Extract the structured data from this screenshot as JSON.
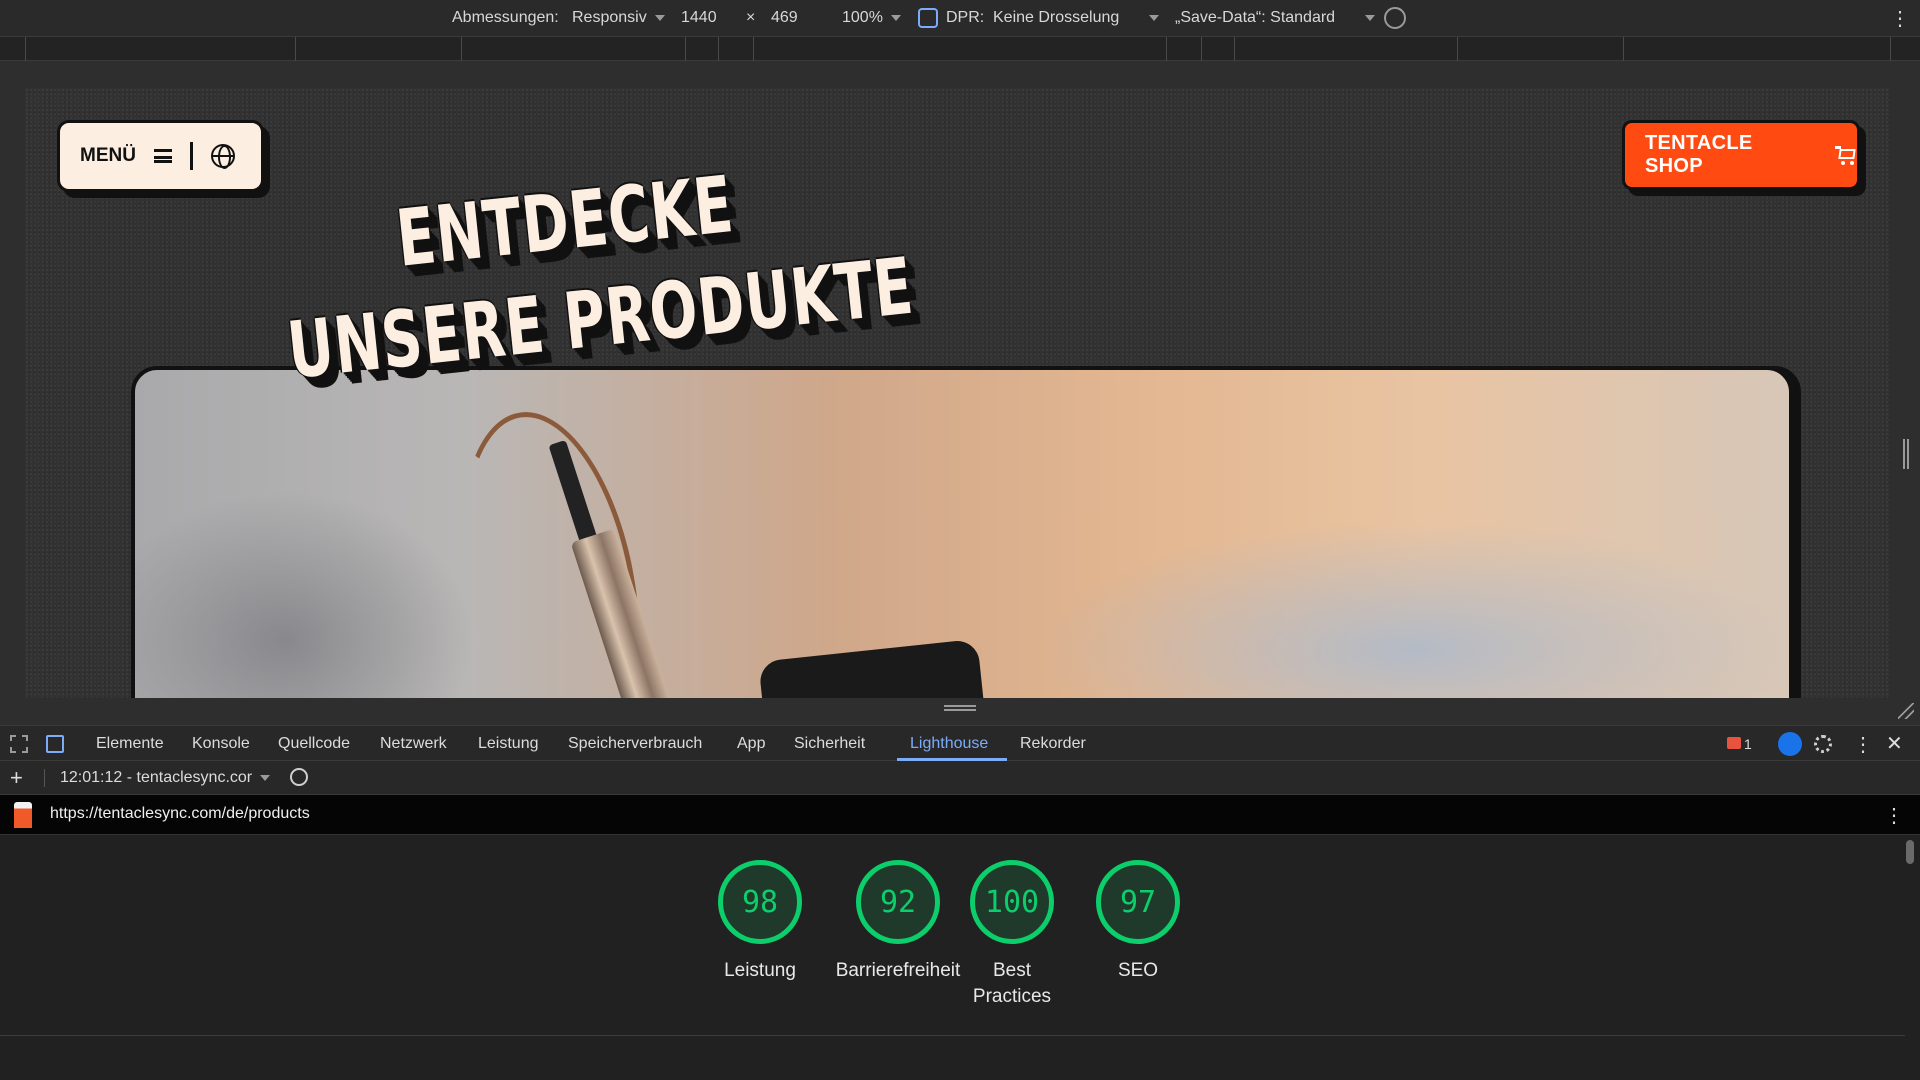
{
  "device_toolbar": {
    "dimensions_label": "Abmessungen:",
    "dimensions_value": "Responsiv",
    "width": "1440",
    "times": "×",
    "height": "469",
    "zoom": "100%",
    "dpr_label": "DPR:",
    "throttling": "Keine Drosselung",
    "save_data": "„Save-Data“: Standard"
  },
  "site": {
    "menu_label": "MENÜ",
    "shop_label": "TENTACLE SHOP",
    "headline_line1": "ENTDECKE",
    "headline_line2": "UNSERE PRODUKTE"
  },
  "devtools": {
    "tabs": [
      "Elemente",
      "Konsole",
      "Quellcode",
      "Netzwerk",
      "Leistung",
      "Speicherverbrauch",
      "App",
      "Sicherheit",
      "Lighthouse",
      "Rekorder"
    ],
    "active_tab": "Lighthouse",
    "issues_count": "1"
  },
  "lighthouse": {
    "report_select": "12:01:12 - tentaclesync.cor",
    "url": "https://tentaclesync.com/de/products",
    "scores": [
      {
        "value": "98",
        "label": "Leistung"
      },
      {
        "value": "92",
        "label": "Barrierefreiheit"
      },
      {
        "value": "100",
        "label": "Best Practices"
      },
      {
        "value": "97",
        "label": "SEO"
      }
    ],
    "score_color": "#0cce6b"
  },
  "colors": {
    "accent_orange": "#ff4b12",
    "cream": "#fdeee2",
    "devtools_blue": "#7cacf8"
  }
}
